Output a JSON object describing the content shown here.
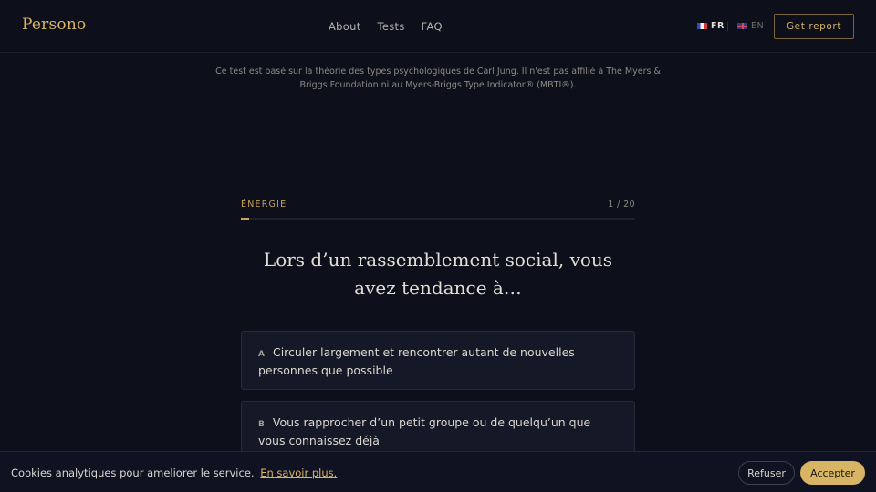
{
  "header": {
    "logo": "Persono",
    "nav": [
      {
        "label": "About"
      },
      {
        "label": "Tests"
      },
      {
        "label": "FAQ"
      }
    ],
    "languages": [
      {
        "code": "FR",
        "active": true,
        "flag": "flag-fr-icon"
      },
      {
        "code": "EN",
        "active": false,
        "flag": "flag-uk-icon"
      }
    ],
    "cta_label": "Get report"
  },
  "disclaimer": "Ce test est basé sur la théorie des types psychologiques de Carl Jung. Il n'est pas affilié à The Myers & Briggs Foundation ni au Myers-Briggs Type Indicator® (MBTI®).",
  "quiz": {
    "category": "ÉNERGIE",
    "counter": "1 / 20",
    "progress": 0.02,
    "question": "Lors d’un rassemblement social, vous avez tendance à…",
    "answers": [
      {
        "letter": "A",
        "text": "Circuler largement et rencontrer autant de nouvelles personnes que possible"
      },
      {
        "letter": "B",
        "text": "Vous rapprocher d’un petit groupe ou de quelqu’un que vous connaissez déjà"
      }
    ]
  },
  "cookie": {
    "text": "Cookies analytiques pour ameliorer le service.",
    "link": "En savoir plus.",
    "refuse": "Refuser",
    "accept": "Accepter"
  },
  "colors": {
    "background": "#0d0f1a",
    "accent": "#d8b565",
    "card": "#151826"
  }
}
